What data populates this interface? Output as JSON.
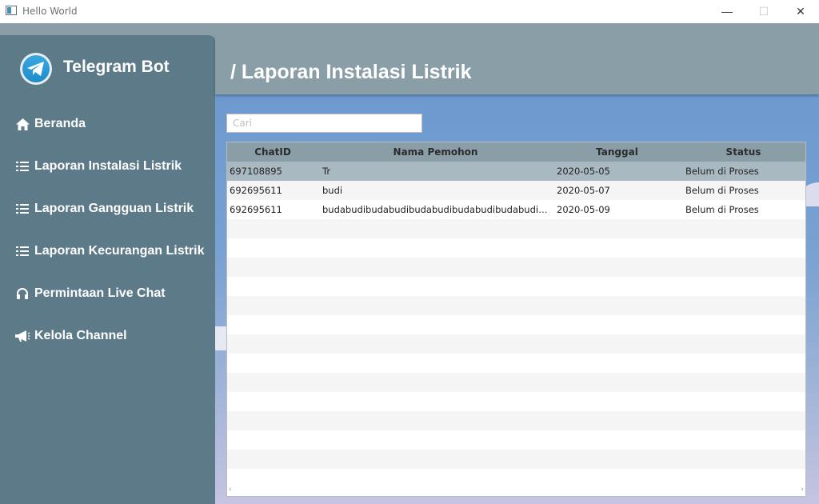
{
  "window": {
    "title": "Hello World",
    "minimize": "—",
    "maximize": "☐",
    "close": "✕"
  },
  "sidebar": {
    "brand": "Telegram Bot",
    "items": [
      {
        "label": "Beranda",
        "icon": "home-icon"
      },
      {
        "label": "Laporan Instalasi Listrik",
        "icon": "list-icon"
      },
      {
        "label": "Laporan Gangguan Listrik",
        "icon": "list-icon"
      },
      {
        "label": "Laporan Kecurangan Listrik",
        "icon": "list-icon"
      },
      {
        "label": "Permintaan Live Chat",
        "icon": "headset-icon"
      },
      {
        "label": "Kelola Channel",
        "icon": "megaphone-icon"
      }
    ]
  },
  "header": {
    "title": "/ Laporan Instalasi Listrik"
  },
  "search": {
    "placeholder": "Cari",
    "value": ""
  },
  "table": {
    "columns": [
      "ChatID",
      "Nama Pemohon",
      "Tanggal",
      "Status"
    ],
    "rows": [
      {
        "chatid": "697108895",
        "nama": "Tr",
        "tanggal": "2020-05-05",
        "status": "Belum di Proses"
      },
      {
        "chatid": "692695611",
        "nama": "budi",
        "tanggal": "2020-05-07",
        "status": "Belum di Proses"
      },
      {
        "chatid": "692695611",
        "nama": "budabudibudabudibudabudibudabudibudabudibud...",
        "tanggal": "2020-05-09",
        "status": "Belum di Proses"
      }
    ],
    "selected_row": 0,
    "scroll_left": "‹",
    "scroll_right": "›"
  },
  "colors": {
    "sidebar": "#5d7a88",
    "header": "#8a9ea7",
    "selected_row": "#a9b9c1",
    "telegram": "#2a9ad6"
  }
}
